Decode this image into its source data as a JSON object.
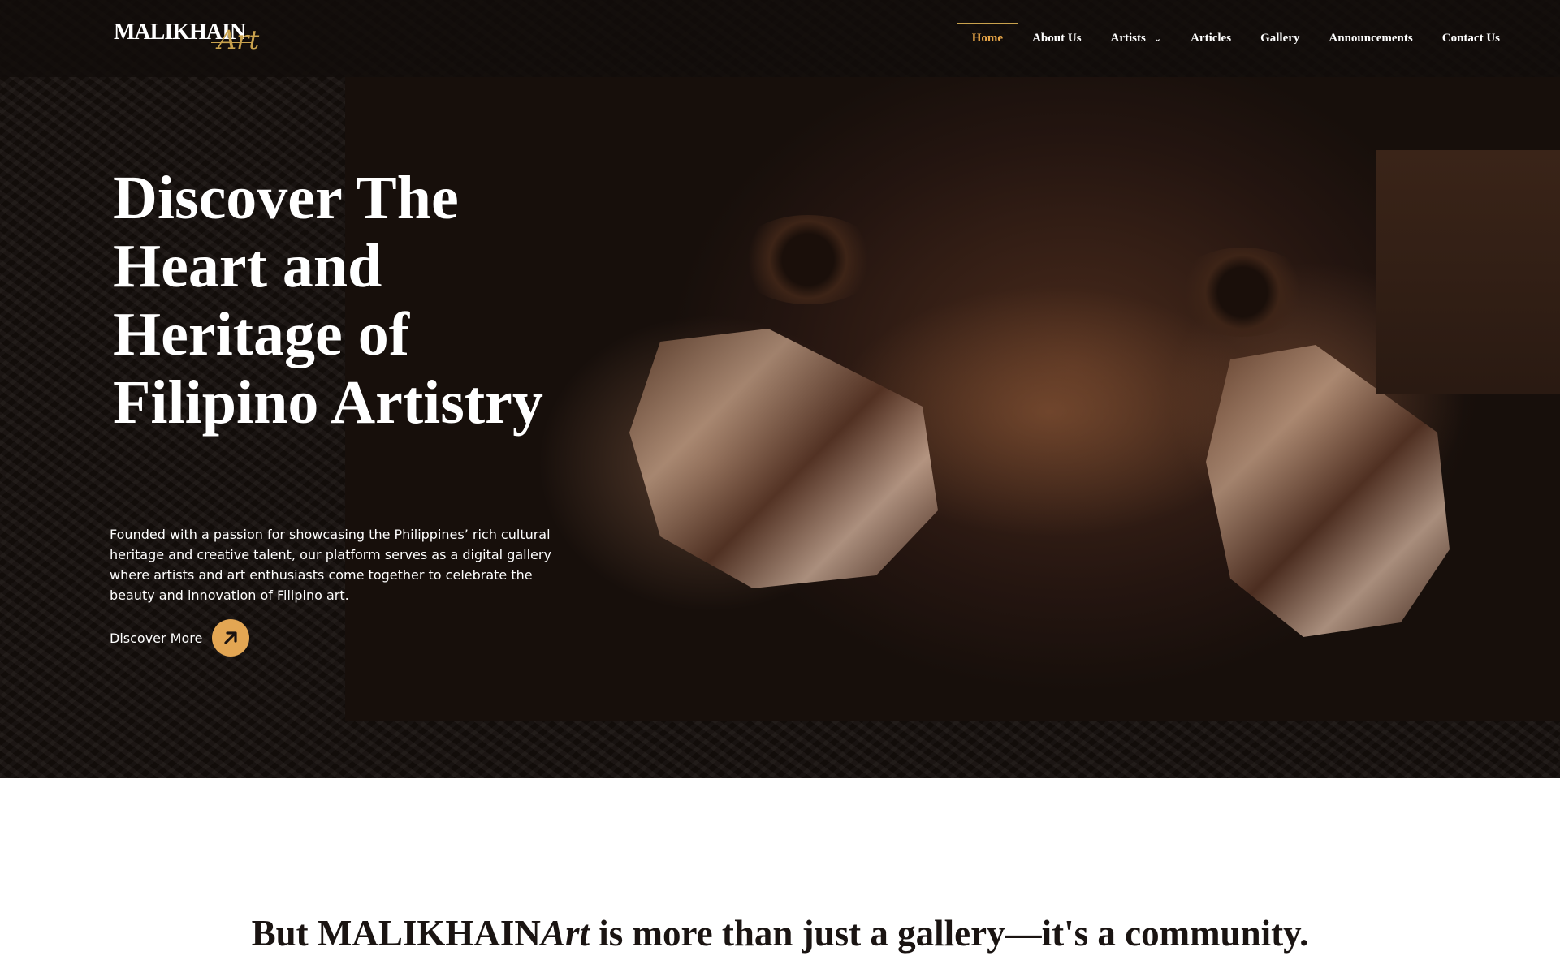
{
  "brand": {
    "name_main": "MALIKHAIN",
    "name_script": "Art",
    "accent_color": "#c9a24d"
  },
  "nav": {
    "items": [
      {
        "label": "Home",
        "active": true
      },
      {
        "label": "About Us"
      },
      {
        "label": "Artists",
        "has_dropdown": true
      },
      {
        "label": "Articles"
      },
      {
        "label": "Gallery"
      },
      {
        "label": "Announcements"
      },
      {
        "label": "Contact Us"
      }
    ],
    "dropdown_icon": "chevron-down-icon",
    "active_color": "#e8a648"
  },
  "hero": {
    "title": "Discover The Heart and Heritage of Filipino Artistry",
    "description": "Founded with a passion for showcasing the Philippines’ rich cultural heritage and creative talent, our platform serves as a digital gallery where artists and art enthusiasts come together to celebrate the beauty and innovation of Filipino art.",
    "cta_label": "Discover More",
    "cta_icon": "arrow-up-right-icon",
    "cta_color": "#e3a653"
  },
  "intro": {
    "prefix": "But MALIKHAIN",
    "brand_script": "Art",
    "suffix": " is more than just a gallery—it's a community."
  }
}
